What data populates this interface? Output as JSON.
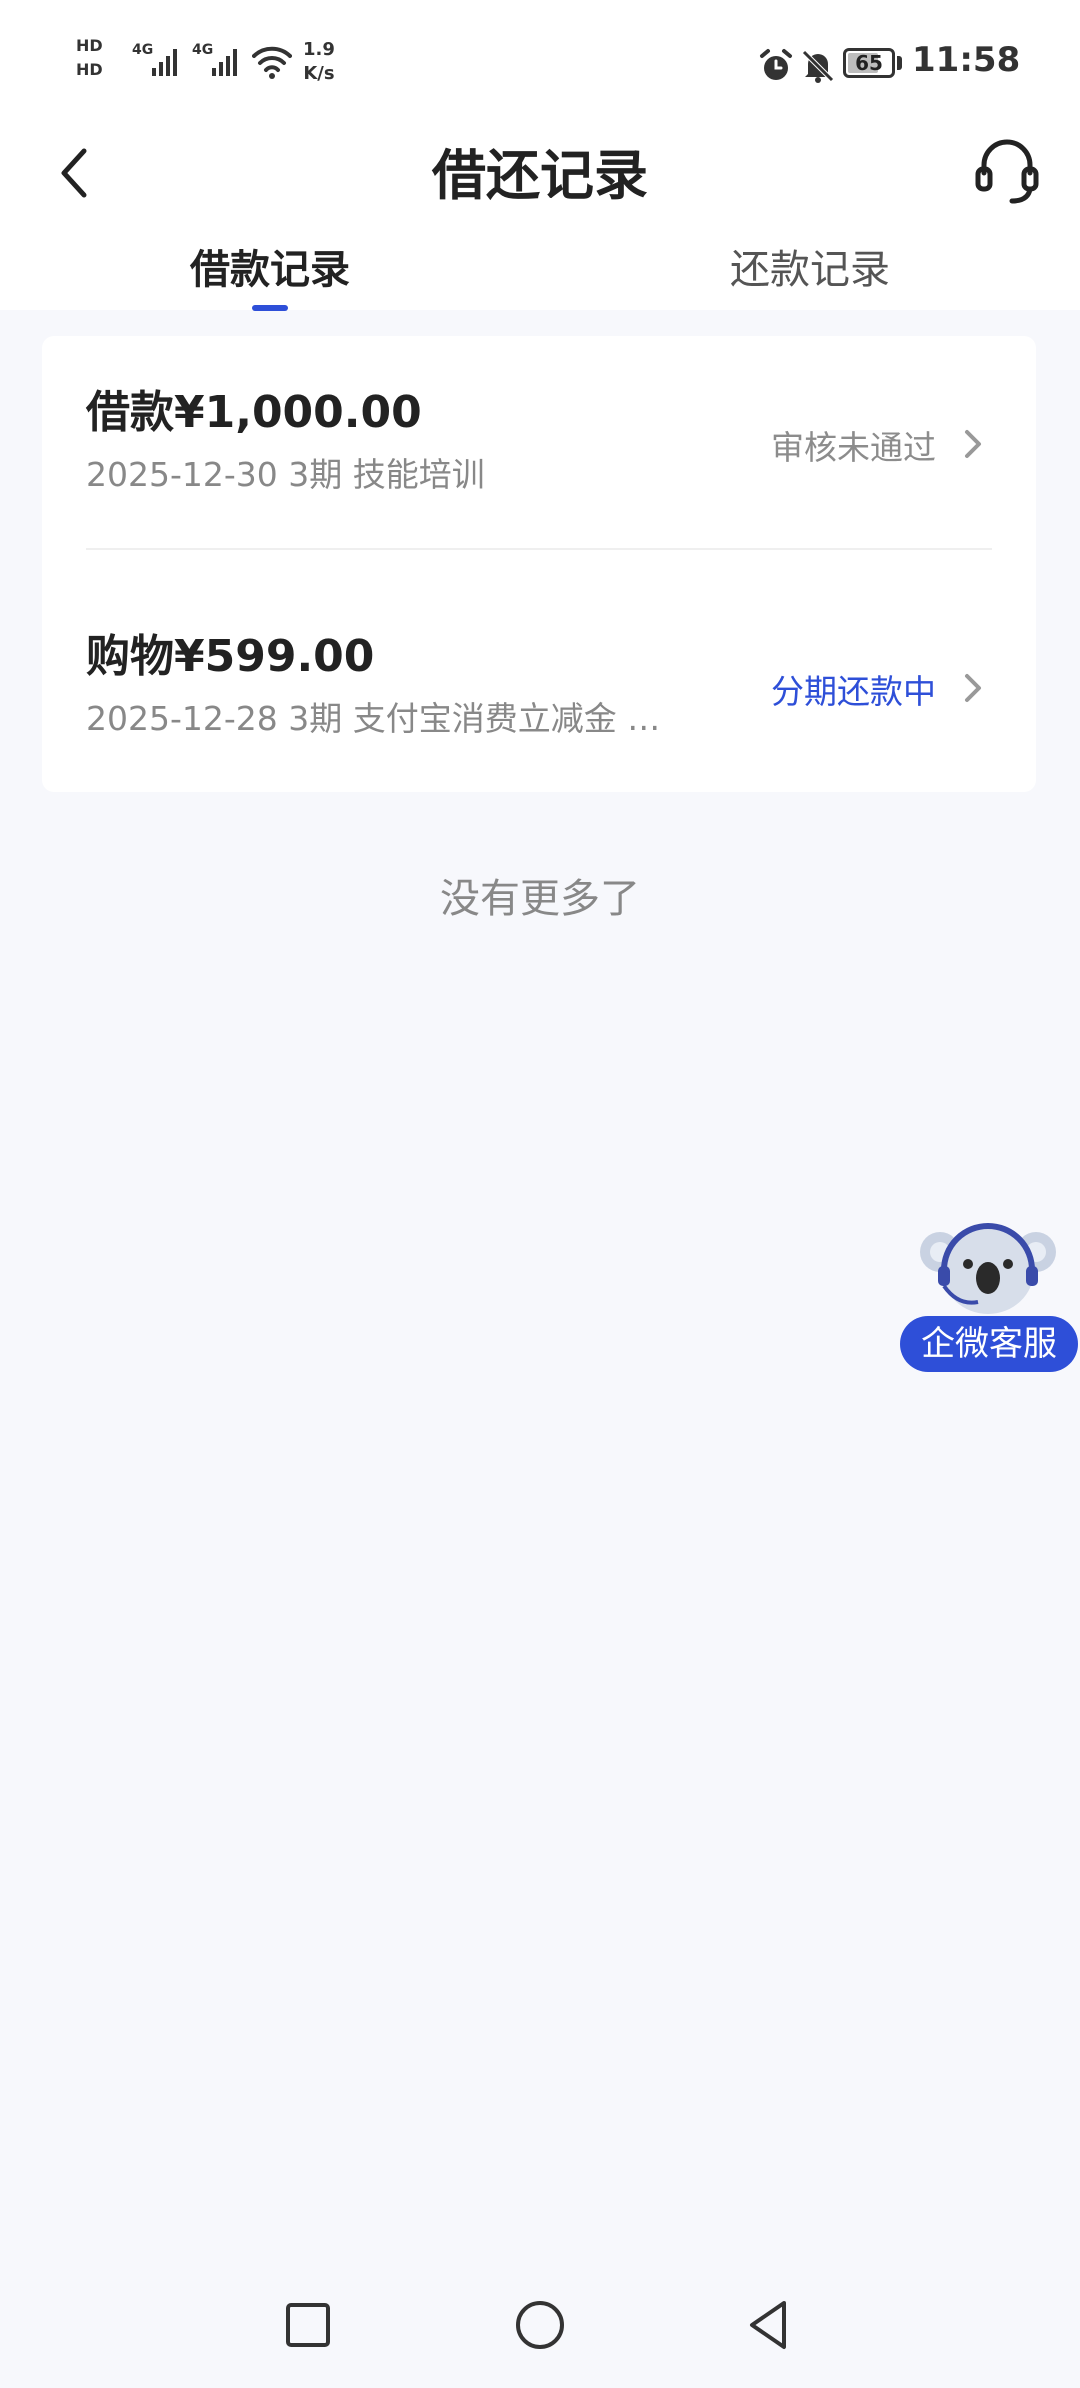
{
  "status_bar": {
    "hd1": "HD",
    "hd2": "HD",
    "sim1_label": "4G",
    "sim2_label": "4G",
    "speed_value": "1.9",
    "speed_unit": "K/s",
    "battery_level": "65",
    "time": "11:58",
    "icons": [
      "signal-icon",
      "wifi-icon",
      "alarm-icon",
      "mute-icon",
      "battery-icon"
    ]
  },
  "header": {
    "title": "借还记录",
    "back_icon": "chevron-left-icon",
    "support_icon": "headset-icon"
  },
  "tabs": [
    {
      "label": "借款记录",
      "active": true
    },
    {
      "label": "还款记录",
      "active": false
    }
  ],
  "records": [
    {
      "title": "借款¥1,000.00",
      "subtitle": "2025-12-30 3期  技能培训",
      "status": "审核未通过",
      "status_color": "#8C8C8C"
    },
    {
      "title": "购物¥599.00",
      "subtitle": "2025-12-28 3期  支付宝消费立减金 消...",
      "status": "分期还款中",
      "status_color": "#2E4FD8"
    }
  ],
  "list_end_text": "没有更多了",
  "floating_service": {
    "label": "企微客服",
    "icon": "koala-mascot-icon"
  },
  "theme": {
    "accent": "#2E4FD8",
    "background": "#F7F8FC"
  }
}
